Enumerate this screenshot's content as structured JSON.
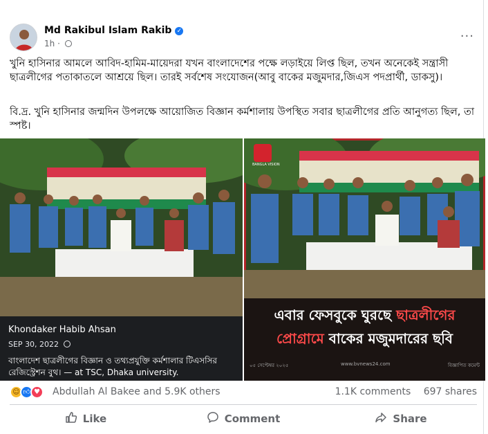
{
  "post": {
    "author": "Md Rakibul Islam Rakib",
    "time": "1h",
    "more_label": "···",
    "text_1": "খুনি হাসিনার আমলে আবিদ-হামিম-মায়েদরা যখন বাংলাদেশের পক্ষে লড়াইয়ে লিপ্ত ছিল, তখন অনেকেই সন্ত্রাসী ছাত্রলীগের পতাকাতলে আশ্রয়ে ছিল। তারই সর্বশেষ সংযোজন(আবু বাকের মজুমদার,জিএস পদপ্রার্থী, ডাকসু)।",
    "text_2": "বি.দ্র. খুনি হাসিনার জন্মদিন উপলক্ষে আয়োজিত বিজ্ঞান কর্মশালায় উপস্থিত সবার ছাত্রলীগের প্রতি আনুগত্য ছিল, তা স্পষ্ট।"
  },
  "photo_left": {
    "overlay_name": "Khondaker Habib Ahsan",
    "overlay_date": "SEP 30, 2022",
    "overlay_caption": "বাংলাদেশ ছাত্রলীগের বিজ্ঞান ও তথ্যপ্রযুক্তি কর্মশালার টিএসসির রেজিস্ট্রেশন বুথ। — at TSC, Dhaka university."
  },
  "photo_right": {
    "logo_text": "BANGLA VISION",
    "banner_line1_plain": "এবার ফেসবুকে ঘুরছে ",
    "banner_line1_highlight": "ছাত্রলীগের",
    "banner_line2_highlight": "প্রোগ্রামে",
    "banner_line2_plain": " বাকের মজুমদারের ছবি",
    "foot_date": "০৫ সেপ্টেম্বর ২০২৫",
    "foot_url": "www.bvnews24.com",
    "foot_ad": "বিজ্ঞাপিত কমেন্ট"
  },
  "reactions": {
    "names": "Abdullah Al Bakee and 5.9K others",
    "comments": "1.1K comments",
    "shares": "697 shares"
  },
  "actions": {
    "like": "Like",
    "comment": "Comment",
    "share": "Share"
  },
  "colors": {
    "facebook_blue": "#1877f2",
    "secondary_text": "#65676b",
    "highlight_red": "#ff4a4a",
    "love_red": "#f33e58",
    "haha_yellow": "#f7b928"
  },
  "icons": [
    "verified-badge-icon",
    "globe-icon",
    "more-icon",
    "like-icon",
    "comment-icon",
    "share-icon",
    "haha-reaction-icon",
    "like-reaction-icon",
    "love-reaction-icon"
  ]
}
